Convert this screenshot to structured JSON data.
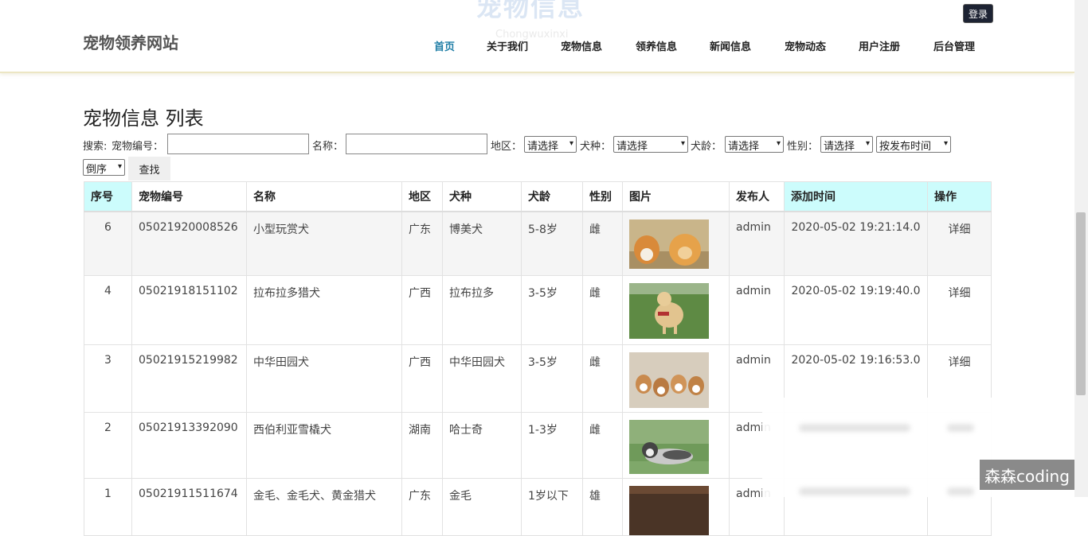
{
  "header": {
    "watermark_title": "宠物信息",
    "watermark_sub": "Chongwuxinxi",
    "logo": "宠物领养网站",
    "login": "登录",
    "nav": [
      "首页",
      "关于我们",
      "宠物信息",
      "领养信息",
      "新闻信息",
      "宠物动态",
      "用户注册",
      "后台管理"
    ]
  },
  "page_title": "宠物信息 列表",
  "search": {
    "label_search": "搜索:",
    "label_code": "宠物编号：",
    "code_value": "",
    "label_name": "名称：",
    "name_value": "",
    "label_region": "地区：",
    "region_selected": "请选择",
    "label_breed": "犬种：",
    "breed_selected": "请选择",
    "label_age": "犬龄：",
    "age_selected": "请选择",
    "label_gender": "性别：",
    "gender_selected": "请选择",
    "sort_selected": "按发布时间",
    "order_selected": "倒序",
    "find_button": "查找"
  },
  "table": {
    "headers": [
      "序号",
      "宠物编号",
      "名称",
      "地区",
      "犬种",
      "犬龄",
      "性别",
      "图片",
      "发布人",
      "添加时间",
      "操作"
    ],
    "rows": [
      {
        "no": "6",
        "code": "05021920008526",
        "name": "小型玩赏犬",
        "region": "广东",
        "breed": "博美犬",
        "age": "5-8岁",
        "gender": "雌",
        "image": "corgi-pomeranian-photo",
        "publisher": "admin",
        "time": "2020-05-02 19:21:14.0",
        "action": "详细"
      },
      {
        "no": "4",
        "code": "05021918151102",
        "name": "拉布拉多猎犬",
        "region": "广西",
        "breed": "拉布拉多",
        "age": "3-5岁",
        "gender": "雌",
        "image": "labrador-photo",
        "publisher": "admin",
        "time": "2020-05-02 19:19:40.0",
        "action": "详细"
      },
      {
        "no": "3",
        "code": "05021915219982",
        "name": "中华田园犬",
        "region": "广西",
        "breed": "中华田园犬",
        "age": "3-5岁",
        "gender": "雌",
        "image": "puppies-photo",
        "publisher": "admin",
        "time": "2020-05-02 19:16:53.0",
        "action": "详细"
      },
      {
        "no": "2",
        "code": "05021913392090",
        "name": "西伯利亚雪橇犬",
        "region": "湖南",
        "breed": "哈士奇",
        "age": "1-3岁",
        "gender": "雌",
        "image": "husky-photo",
        "publisher": "admin",
        "time": "",
        "action": ""
      },
      {
        "no": "1",
        "code": "05021911511674",
        "name": "金毛、金毛犬、黄金猎犬",
        "region": "广东",
        "breed": "金毛",
        "age": "1岁以下",
        "gender": "雄",
        "image": "golden-photo",
        "publisher": "admin",
        "time": "",
        "action": ""
      }
    ]
  },
  "brand": "森森coding"
}
